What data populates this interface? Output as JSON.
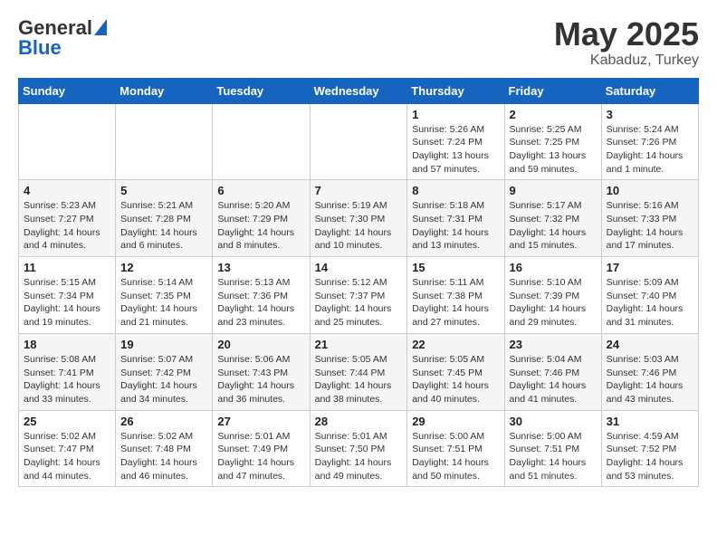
{
  "header": {
    "logo_general": "General",
    "logo_blue": "Blue",
    "month_year": "May 2025",
    "location": "Kabaduz, Turkey"
  },
  "weekdays": [
    "Sunday",
    "Monday",
    "Tuesday",
    "Wednesday",
    "Thursday",
    "Friday",
    "Saturday"
  ],
  "weeks": [
    [
      {
        "day": "",
        "sunrise": "",
        "sunset": "",
        "daylight": ""
      },
      {
        "day": "",
        "sunrise": "",
        "sunset": "",
        "daylight": ""
      },
      {
        "day": "",
        "sunrise": "",
        "sunset": "",
        "daylight": ""
      },
      {
        "day": "",
        "sunrise": "",
        "sunset": "",
        "daylight": ""
      },
      {
        "day": "1",
        "sunrise": "Sunrise: 5:26 AM",
        "sunset": "Sunset: 7:24 PM",
        "daylight": "Daylight: 13 hours and 57 minutes."
      },
      {
        "day": "2",
        "sunrise": "Sunrise: 5:25 AM",
        "sunset": "Sunset: 7:25 PM",
        "daylight": "Daylight: 13 hours and 59 minutes."
      },
      {
        "day": "3",
        "sunrise": "Sunrise: 5:24 AM",
        "sunset": "Sunset: 7:26 PM",
        "daylight": "Daylight: 14 hours and 1 minute."
      }
    ],
    [
      {
        "day": "4",
        "sunrise": "Sunrise: 5:23 AM",
        "sunset": "Sunset: 7:27 PM",
        "daylight": "Daylight: 14 hours and 4 minutes."
      },
      {
        "day": "5",
        "sunrise": "Sunrise: 5:21 AM",
        "sunset": "Sunset: 7:28 PM",
        "daylight": "Daylight: 14 hours and 6 minutes."
      },
      {
        "day": "6",
        "sunrise": "Sunrise: 5:20 AM",
        "sunset": "Sunset: 7:29 PM",
        "daylight": "Daylight: 14 hours and 8 minutes."
      },
      {
        "day": "7",
        "sunrise": "Sunrise: 5:19 AM",
        "sunset": "Sunset: 7:30 PM",
        "daylight": "Daylight: 14 hours and 10 minutes."
      },
      {
        "day": "8",
        "sunrise": "Sunrise: 5:18 AM",
        "sunset": "Sunset: 7:31 PM",
        "daylight": "Daylight: 14 hours and 13 minutes."
      },
      {
        "day": "9",
        "sunrise": "Sunrise: 5:17 AM",
        "sunset": "Sunset: 7:32 PM",
        "daylight": "Daylight: 14 hours and 15 minutes."
      },
      {
        "day": "10",
        "sunrise": "Sunrise: 5:16 AM",
        "sunset": "Sunset: 7:33 PM",
        "daylight": "Daylight: 14 hours and 17 minutes."
      }
    ],
    [
      {
        "day": "11",
        "sunrise": "Sunrise: 5:15 AM",
        "sunset": "Sunset: 7:34 PM",
        "daylight": "Daylight: 14 hours and 19 minutes."
      },
      {
        "day": "12",
        "sunrise": "Sunrise: 5:14 AM",
        "sunset": "Sunset: 7:35 PM",
        "daylight": "Daylight: 14 hours and 21 minutes."
      },
      {
        "day": "13",
        "sunrise": "Sunrise: 5:13 AM",
        "sunset": "Sunset: 7:36 PM",
        "daylight": "Daylight: 14 hours and 23 minutes."
      },
      {
        "day": "14",
        "sunrise": "Sunrise: 5:12 AM",
        "sunset": "Sunset: 7:37 PM",
        "daylight": "Daylight: 14 hours and 25 minutes."
      },
      {
        "day": "15",
        "sunrise": "Sunrise: 5:11 AM",
        "sunset": "Sunset: 7:38 PM",
        "daylight": "Daylight: 14 hours and 27 minutes."
      },
      {
        "day": "16",
        "sunrise": "Sunrise: 5:10 AM",
        "sunset": "Sunset: 7:39 PM",
        "daylight": "Daylight: 14 hours and 29 minutes."
      },
      {
        "day": "17",
        "sunrise": "Sunrise: 5:09 AM",
        "sunset": "Sunset: 7:40 PM",
        "daylight": "Daylight: 14 hours and 31 minutes."
      }
    ],
    [
      {
        "day": "18",
        "sunrise": "Sunrise: 5:08 AM",
        "sunset": "Sunset: 7:41 PM",
        "daylight": "Daylight: 14 hours and 33 minutes."
      },
      {
        "day": "19",
        "sunrise": "Sunrise: 5:07 AM",
        "sunset": "Sunset: 7:42 PM",
        "daylight": "Daylight: 14 hours and 34 minutes."
      },
      {
        "day": "20",
        "sunrise": "Sunrise: 5:06 AM",
        "sunset": "Sunset: 7:43 PM",
        "daylight": "Daylight: 14 hours and 36 minutes."
      },
      {
        "day": "21",
        "sunrise": "Sunrise: 5:05 AM",
        "sunset": "Sunset: 7:44 PM",
        "daylight": "Daylight: 14 hours and 38 minutes."
      },
      {
        "day": "22",
        "sunrise": "Sunrise: 5:05 AM",
        "sunset": "Sunset: 7:45 PM",
        "daylight": "Daylight: 14 hours and 40 minutes."
      },
      {
        "day": "23",
        "sunrise": "Sunrise: 5:04 AM",
        "sunset": "Sunset: 7:46 PM",
        "daylight": "Daylight: 14 hours and 41 minutes."
      },
      {
        "day": "24",
        "sunrise": "Sunrise: 5:03 AM",
        "sunset": "Sunset: 7:46 PM",
        "daylight": "Daylight: 14 hours and 43 minutes."
      }
    ],
    [
      {
        "day": "25",
        "sunrise": "Sunrise: 5:02 AM",
        "sunset": "Sunset: 7:47 PM",
        "daylight": "Daylight: 14 hours and 44 minutes."
      },
      {
        "day": "26",
        "sunrise": "Sunrise: 5:02 AM",
        "sunset": "Sunset: 7:48 PM",
        "daylight": "Daylight: 14 hours and 46 minutes."
      },
      {
        "day": "27",
        "sunrise": "Sunrise: 5:01 AM",
        "sunset": "Sunset: 7:49 PM",
        "daylight": "Daylight: 14 hours and 47 minutes."
      },
      {
        "day": "28",
        "sunrise": "Sunrise: 5:01 AM",
        "sunset": "Sunset: 7:50 PM",
        "daylight": "Daylight: 14 hours and 49 minutes."
      },
      {
        "day": "29",
        "sunrise": "Sunrise: 5:00 AM",
        "sunset": "Sunset: 7:51 PM",
        "daylight": "Daylight: 14 hours and 50 minutes."
      },
      {
        "day": "30",
        "sunrise": "Sunrise: 5:00 AM",
        "sunset": "Sunset: 7:51 PM",
        "daylight": "Daylight: 14 hours and 51 minutes."
      },
      {
        "day": "31",
        "sunrise": "Sunrise: 4:59 AM",
        "sunset": "Sunset: 7:52 PM",
        "daylight": "Daylight: 14 hours and 53 minutes."
      }
    ]
  ]
}
